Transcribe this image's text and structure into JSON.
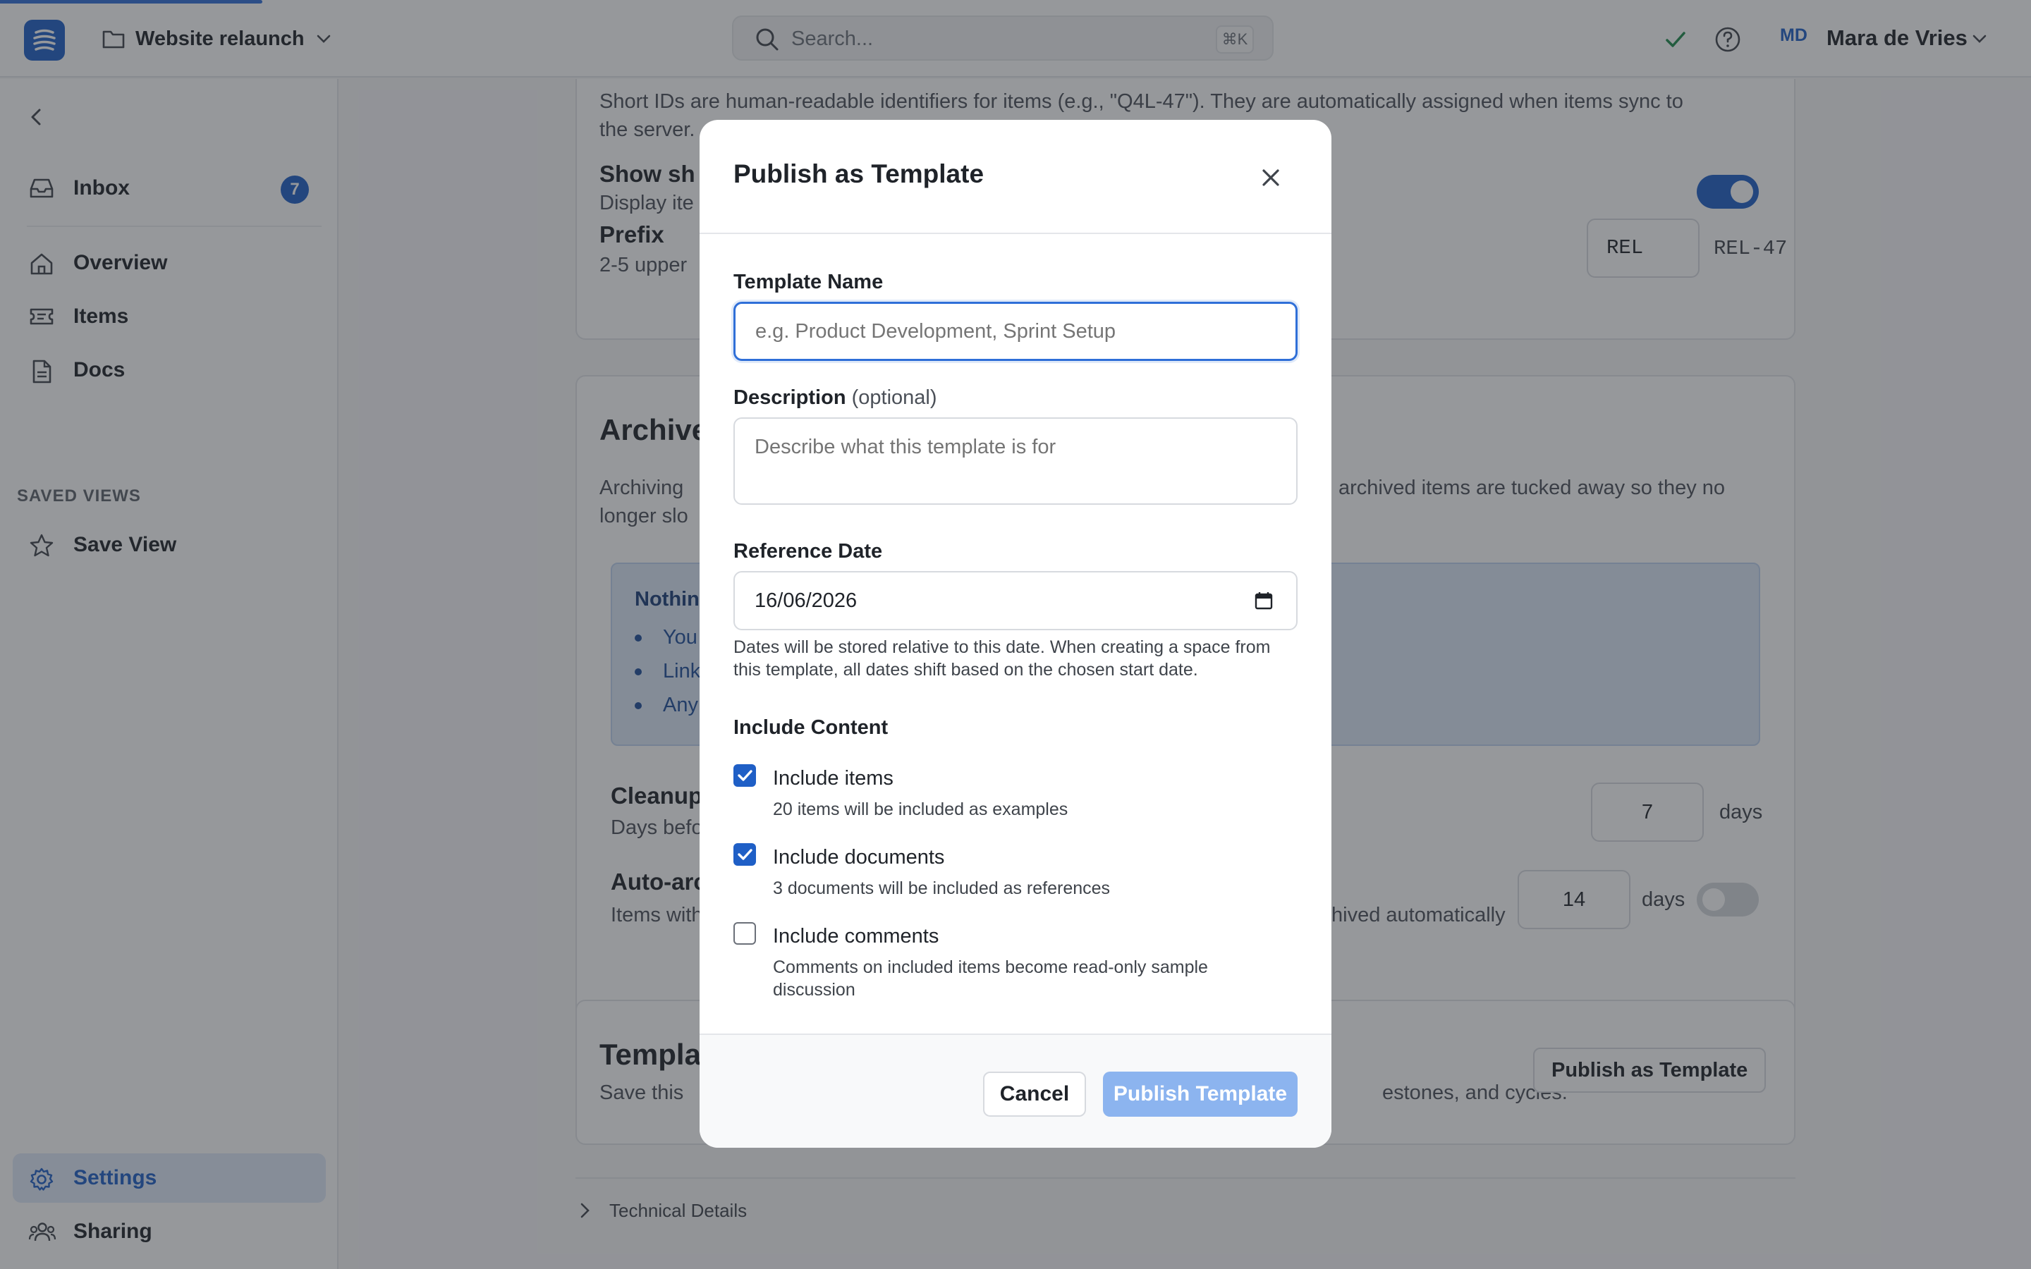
{
  "topbar": {
    "workspace_name": "Website relaunch",
    "search_placeholder": "Search...",
    "search_shortcut": "⌘K",
    "user_initials": "MD",
    "user_name": "Mara de Vries"
  },
  "sidebar": {
    "inbox_label": "Inbox",
    "inbox_count": "7",
    "items": [
      {
        "label": "Overview",
        "icon": "home-icon"
      },
      {
        "label": "Items",
        "icon": "ticket-icon"
      },
      {
        "label": "Docs",
        "icon": "document-icon"
      }
    ],
    "saved_views_heading": "SAVED VIEWS",
    "save_view_label": "Save View",
    "bottom_items": [
      {
        "label": "Settings",
        "icon": "gear-icon",
        "active": true
      },
      {
        "label": "Sharing",
        "icon": "users-icon",
        "active": false
      }
    ]
  },
  "settings": {
    "short_ids_desc_line1": "Short IDs are human-readable identifiers for items (e.g., \"Q4L-47\"). They are automatically assigned when items sync to",
    "short_ids_desc_line2": "the server.",
    "show_short_title": "Show sh",
    "show_short_desc": "Display ite",
    "show_short_enabled": true,
    "prefix_title": "Prefix",
    "prefix_desc": "2-5 upper",
    "prefix_value": "REL",
    "prefix_example": "REL-47",
    "archive_title": "Archive",
    "archive_desc_left": "Archiving",
    "archive_desc_right": "archived items are tucked away so they no",
    "archive_desc_line2": "longer slo",
    "info_title": "Nothing",
    "info_bullets": [
      "You",
      "Link",
      "Any"
    ],
    "cleanup_title": "Cleanup",
    "cleanup_desc": "Days befo",
    "cleanup_days": "7",
    "days_unit": "days",
    "auto_archive_title": "Auto-arc",
    "auto_archive_desc_left": "Items with",
    "auto_archive_desc_right": "hived automatically",
    "auto_archive_days": "14",
    "auto_archive_enabled": false,
    "templates_title": "Templa",
    "templates_desc_left": "Save this",
    "templates_desc_right": "estones, and cycles.",
    "publish_button": "Publish as Template",
    "technical_details": "Technical Details"
  },
  "modal": {
    "title": "Publish as Template",
    "name_label": "Template Name",
    "name_placeholder": "e.g. Product Development, Sprint Setup",
    "description_label": "Description",
    "description_optional": "(optional)",
    "description_placeholder": "Describe what this template is for",
    "reference_date_label": "Reference Date",
    "reference_date_value": "16/06/2026",
    "reference_date_help": "Dates will be stored relative to this date. When creating a space from this template, all dates shift based on the chosen start date.",
    "include_heading": "Include Content",
    "options": [
      {
        "label": "Include items",
        "sub": "20 items will be included as examples",
        "checked": true
      },
      {
        "label": "Include documents",
        "sub": "3 documents will be included as references",
        "checked": true
      },
      {
        "label": "Include comments",
        "sub": "Comments on included items become read-only sample discussion",
        "checked": false
      }
    ],
    "cancel_label": "Cancel",
    "submit_label": "Publish Template"
  },
  "colors": {
    "accent": "#1f5fc6",
    "success": "#1e8a4c",
    "primary_disabled": "#8cb4ef",
    "info_bg": "#dce8f8"
  }
}
